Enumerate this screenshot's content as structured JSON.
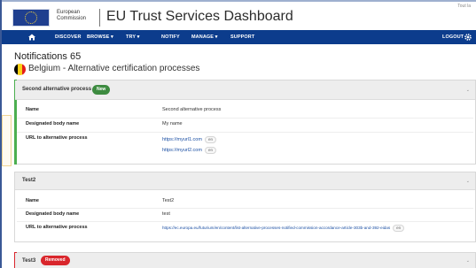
{
  "header": {
    "commission_line1": "European",
    "commission_line2": "Commission",
    "app_title": "EU Trust Services Dashboard",
    "top_right": "Tout la"
  },
  "nav": {
    "items": [
      {
        "label": "DISCOVER"
      },
      {
        "label": "BROWSE ▾"
      },
      {
        "label": "TRY ▾"
      },
      {
        "label": "NOTIFY"
      },
      {
        "label": "MANAGE ▾"
      },
      {
        "label": "SUPPORT"
      }
    ],
    "logout": "LOGOUT"
  },
  "page": {
    "title": "Notifications 65",
    "country_title": "Belgium - Alternative certification processes"
  },
  "colors": {
    "nav_bg": "#0c3c8c",
    "badge_new": "#3d8b40",
    "badge_removed": "#d9262c",
    "flag_black": "#000000",
    "flag_yellow": "#f7d117",
    "flag_red": "#e31d1a"
  },
  "panels": [
    {
      "title": "Second alternative process",
      "badge": "New",
      "rows": [
        {
          "label": "Name",
          "value": "Second alternative process"
        },
        {
          "label": "Designated body name",
          "value": "My name"
        },
        {
          "label": "URL to alternative process",
          "links": [
            {
              "url": "https://myurl1.com",
              "lang": "en"
            },
            {
              "url": "https://myurl2.com",
              "lang": "en"
            }
          ]
        }
      ]
    },
    {
      "title": "Test2",
      "rows": [
        {
          "label": "Name",
          "value": "Test2"
        },
        {
          "label": "Designated body name",
          "value": "test"
        },
        {
          "label": "URL to alternative process",
          "links": [
            {
              "url": "https://ec.europa.eu/futurium/en/content/list-alternative-processes-notified-commission-accordance-article-303b-and-392-eidas",
              "lang": "en"
            }
          ]
        }
      ]
    },
    {
      "title": "Test3",
      "badge": "Removed"
    }
  ],
  "icons": {
    "home": "home-icon",
    "gear": "gear-icon",
    "chevron": "chevron-down-icon"
  }
}
